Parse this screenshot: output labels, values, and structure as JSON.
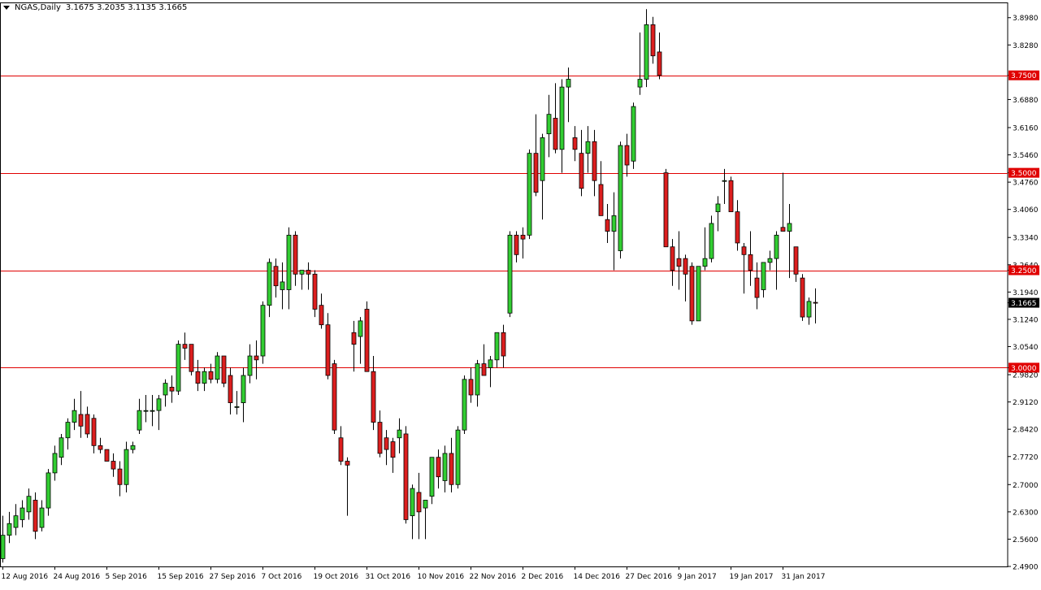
{
  "header": {
    "symbol": "NGAS,Daily",
    "ohlc": "3.1675 3.2035 3.1135 3.1665",
    "dropdown_icon": "triangle-down-icon"
  },
  "colors": {
    "bull": "#32CD32",
    "bear": "#DC1E1E",
    "wick": "#000000",
    "level": "#E00000",
    "price_tag_bg": "#000000",
    "price_tag_fg": "#FFFFFF"
  },
  "chart_data": {
    "type": "candlestick",
    "ylim": [
      2.49,
      3.935
    ],
    "grid": false,
    "price_axis_ticks": [
      "3.8980",
      "3.8280",
      "3.7500",
      "3.6880",
      "3.6160",
      "3.5460",
      "3.5000",
      "3.4760",
      "3.4060",
      "3.3340",
      "3.2640",
      "3.2500",
      "3.1940",
      "3.1665",
      "3.1240",
      "3.0540",
      "3.0000",
      "2.9820",
      "2.9120",
      "2.8420",
      "2.7720",
      "2.7000",
      "2.6300",
      "2.5600",
      "2.4900"
    ],
    "date_ticks": [
      {
        "label": "12 Aug 2016",
        "index": 0
      },
      {
        "label": "24 Aug 2016",
        "index": 8
      },
      {
        "label": "5 Sep 2016",
        "index": 16
      },
      {
        "label": "15 Sep 2016",
        "index": 24
      },
      {
        "label": "27 Sep 2016",
        "index": 32
      },
      {
        "label": "7 Oct 2016",
        "index": 40
      },
      {
        "label": "19 Oct 2016",
        "index": 48
      },
      {
        "label": "31 Oct 2016",
        "index": 56
      },
      {
        "label": "10 Nov 2016",
        "index": 64
      },
      {
        "label": "22 Nov 2016",
        "index": 72
      },
      {
        "label": "2 Dec 2016",
        "index": 80
      },
      {
        "label": "14 Dec 2016",
        "index": 88
      },
      {
        "label": "27 Dec 2016",
        "index": 96
      },
      {
        "label": "9 Jan 2017",
        "index": 104
      },
      {
        "label": "19 Jan 2017",
        "index": 112
      },
      {
        "label": "31 Jan 2017",
        "index": 120
      }
    ],
    "horizontal_levels": [
      {
        "value": 3.75,
        "label": "3.7500"
      },
      {
        "value": 3.5,
        "label": "3.5000"
      },
      {
        "value": 3.25,
        "label": "3.2500"
      },
      {
        "value": 3.0,
        "label": "3.0000"
      }
    ],
    "current_price": {
      "value": 3.1665,
      "label": "3.1665"
    },
    "ohlc": [
      [
        2.51,
        2.62,
        2.5,
        2.57
      ],
      [
        2.57,
        2.63,
        2.55,
        2.6
      ],
      [
        2.59,
        2.65,
        2.57,
        2.62
      ],
      [
        2.61,
        2.66,
        2.59,
        2.64
      ],
      [
        2.63,
        2.69,
        2.61,
        2.67
      ],
      [
        2.66,
        2.68,
        2.56,
        2.58
      ],
      [
        2.59,
        2.66,
        2.58,
        2.64
      ],
      [
        2.64,
        2.74,
        2.62,
        2.73
      ],
      [
        2.73,
        2.8,
        2.71,
        2.78
      ],
      [
        2.77,
        2.83,
        2.75,
        2.82
      ],
      [
        2.82,
        2.87,
        2.79,
        2.86
      ],
      [
        2.86,
        2.92,
        2.84,
        2.89
      ],
      [
        2.88,
        2.94,
        2.82,
        2.85
      ],
      [
        2.88,
        2.9,
        2.82,
        2.83
      ],
      [
        2.87,
        2.88,
        2.78,
        2.8
      ],
      [
        2.8,
        2.82,
        2.78,
        2.79
      ],
      [
        2.79,
        2.79,
        2.76,
        2.76
      ],
      [
        2.76,
        2.78,
        2.72,
        2.74
      ],
      [
        2.74,
        2.76,
        2.67,
        2.7
      ],
      [
        2.7,
        2.81,
        2.68,
        2.79
      ],
      [
        2.79,
        2.81,
        2.78,
        2.8
      ],
      [
        2.84,
        2.92,
        2.83,
        2.89
      ],
      [
        2.89,
        2.93,
        2.86,
        2.89
      ],
      [
        2.89,
        2.93,
        2.85,
        2.89
      ],
      [
        2.89,
        2.93,
        2.84,
        2.92
      ],
      [
        2.93,
        2.97,
        2.9,
        2.96
      ],
      [
        2.95,
        2.98,
        2.91,
        2.94
      ],
      [
        2.94,
        3.07,
        2.93,
        3.06
      ],
      [
        3.06,
        3.09,
        3.02,
        3.05
      ],
      [
        3.06,
        3.06,
        2.98,
        2.99
      ],
      [
        2.99,
        3.02,
        2.94,
        2.96
      ],
      [
        2.96,
        3.0,
        2.94,
        2.99
      ],
      [
        2.99,
        3.01,
        2.96,
        2.97
      ],
      [
        2.97,
        3.04,
        2.96,
        3.03
      ],
      [
        3.03,
        3.03,
        2.95,
        2.96
      ],
      [
        2.98,
        3.0,
        2.88,
        2.91
      ],
      [
        2.9,
        2.94,
        2.88,
        2.9
      ],
      [
        2.91,
        3.0,
        2.86,
        2.98
      ],
      [
        2.98,
        3.06,
        2.96,
        3.03
      ],
      [
        3.03,
        3.07,
        2.97,
        3.02
      ],
      [
        3.03,
        3.17,
        3.01,
        3.16
      ],
      [
        3.16,
        3.28,
        3.13,
        3.27
      ],
      [
        3.26,
        3.28,
        3.18,
        3.21
      ],
      [
        3.2,
        3.27,
        3.15,
        3.22
      ],
      [
        3.2,
        3.36,
        3.15,
        3.34
      ],
      [
        3.34,
        3.35,
        3.21,
        3.24
      ],
      [
        3.24,
        3.25,
        3.2,
        3.25
      ],
      [
        3.25,
        3.27,
        3.2,
        3.24
      ],
      [
        3.24,
        3.25,
        3.13,
        3.15
      ],
      [
        3.16,
        3.19,
        3.1,
        3.11
      ],
      [
        3.11,
        3.14,
        2.97,
        2.98
      ],
      [
        3.01,
        3.02,
        2.83,
        2.84
      ],
      [
        2.82,
        2.85,
        2.75,
        2.76
      ],
      [
        2.76,
        2.77,
        2.62,
        2.75
      ],
      [
        3.09,
        3.12,
        2.99,
        3.06
      ],
      [
        3.08,
        3.13,
        3.01,
        3.12
      ],
      [
        3.15,
        3.17,
        2.99,
        2.99
      ],
      [
        2.99,
        3.03,
        2.84,
        2.86
      ],
      [
        2.86,
        2.89,
        2.77,
        2.78
      ],
      [
        2.82,
        2.84,
        2.75,
        2.79
      ],
      [
        2.81,
        2.82,
        2.73,
        2.77
      ],
      [
        2.82,
        2.87,
        2.78,
        2.84
      ],
      [
        2.83,
        2.85,
        2.6,
        2.61
      ],
      [
        2.62,
        2.7,
        2.56,
        2.69
      ],
      [
        2.68,
        2.73,
        2.56,
        2.63
      ],
      [
        2.64,
        2.66,
        2.56,
        2.66
      ],
      [
        2.67,
        2.75,
        2.65,
        2.77
      ],
      [
        2.77,
        2.79,
        2.69,
        2.72
      ],
      [
        2.71,
        2.8,
        2.68,
        2.78
      ],
      [
        2.78,
        2.82,
        2.68,
        2.7
      ],
      [
        2.7,
        2.85,
        2.69,
        2.84
      ],
      [
        2.84,
        2.98,
        2.83,
        2.97
      ],
      [
        2.97,
        3.0,
        2.91,
        2.93
      ],
      [
        2.93,
        3.02,
        2.9,
        3.01
      ],
      [
        3.01,
        3.06,
        2.98,
        2.98
      ],
      [
        3.0,
        3.03,
        2.95,
        3.02
      ],
      [
        3.02,
        3.07,
        3.0,
        3.09
      ],
      [
        3.09,
        3.11,
        3.0,
        3.03
      ],
      [
        3.14,
        3.35,
        3.13,
        3.34
      ],
      [
        3.34,
        3.35,
        3.27,
        3.29
      ],
      [
        3.34,
        3.36,
        3.28,
        3.33
      ],
      [
        3.34,
        3.56,
        3.33,
        3.55
      ],
      [
        3.55,
        3.65,
        3.44,
        3.45
      ],
      [
        3.48,
        3.6,
        3.38,
        3.59
      ],
      [
        3.6,
        3.7,
        3.54,
        3.65
      ],
      [
        3.64,
        3.73,
        3.55,
        3.56
      ],
      [
        3.56,
        3.74,
        3.5,
        3.72
      ],
      [
        3.72,
        3.77,
        3.63,
        3.74
      ],
      [
        3.59,
        3.62,
        3.53,
        3.56
      ],
      [
        3.55,
        3.61,
        3.44,
        3.46
      ],
      [
        3.55,
        3.62,
        3.5,
        3.58
      ],
      [
        3.58,
        3.61,
        3.44,
        3.48
      ],
      [
        3.47,
        3.53,
        3.39,
        3.39
      ],
      [
        3.38,
        3.42,
        3.32,
        3.35
      ],
      [
        3.35,
        3.45,
        3.25,
        3.39
      ],
      [
        3.3,
        3.58,
        3.28,
        3.57
      ],
      [
        3.57,
        3.6,
        3.49,
        3.52
      ],
      [
        3.53,
        3.68,
        3.51,
        3.67
      ],
      [
        3.72,
        3.86,
        3.7,
        3.74
      ],
      [
        3.74,
        3.92,
        3.72,
        3.88
      ],
      [
        3.88,
        3.9,
        3.78,
        3.8
      ],
      [
        3.81,
        3.86,
        3.74,
        3.75
      ],
      [
        3.5,
        3.51,
        3.31,
        3.31
      ],
      [
        3.31,
        3.33,
        3.21,
        3.25
      ],
      [
        3.28,
        3.35,
        3.2,
        3.26
      ],
      [
        3.28,
        3.29,
        3.17,
        3.24
      ],
      [
        3.26,
        3.27,
        3.11,
        3.12
      ],
      [
        3.12,
        3.23,
        3.12,
        3.26
      ],
      [
        3.26,
        3.36,
        3.25,
        3.28
      ],
      [
        3.28,
        3.39,
        3.27,
        3.37
      ],
      [
        3.4,
        3.44,
        3.35,
        3.42
      ],
      [
        3.48,
        3.51,
        3.42,
        3.48
      ],
      [
        3.48,
        3.49,
        3.4,
        3.4
      ],
      [
        3.4,
        3.43,
        3.3,
        3.32
      ],
      [
        3.31,
        3.32,
        3.19,
        3.29
      ],
      [
        3.29,
        3.35,
        3.21,
        3.25
      ],
      [
        3.23,
        3.27,
        3.15,
        3.18
      ],
      [
        3.2,
        3.27,
        3.18,
        3.27
      ],
      [
        3.27,
        3.3,
        3.25,
        3.28
      ],
      [
        3.28,
        3.35,
        3.2,
        3.34
      ],
      [
        3.36,
        3.5,
        3.35,
        3.35
      ],
      [
        3.35,
        3.42,
        3.23,
        3.37
      ],
      [
        3.31,
        3.31,
        3.22,
        3.24
      ],
      [
        3.23,
        3.24,
        3.12,
        3.13
      ],
      [
        3.13,
        3.18,
        3.11,
        3.17
      ],
      [
        3.1675,
        3.2035,
        3.1135,
        3.1665
      ]
    ]
  }
}
